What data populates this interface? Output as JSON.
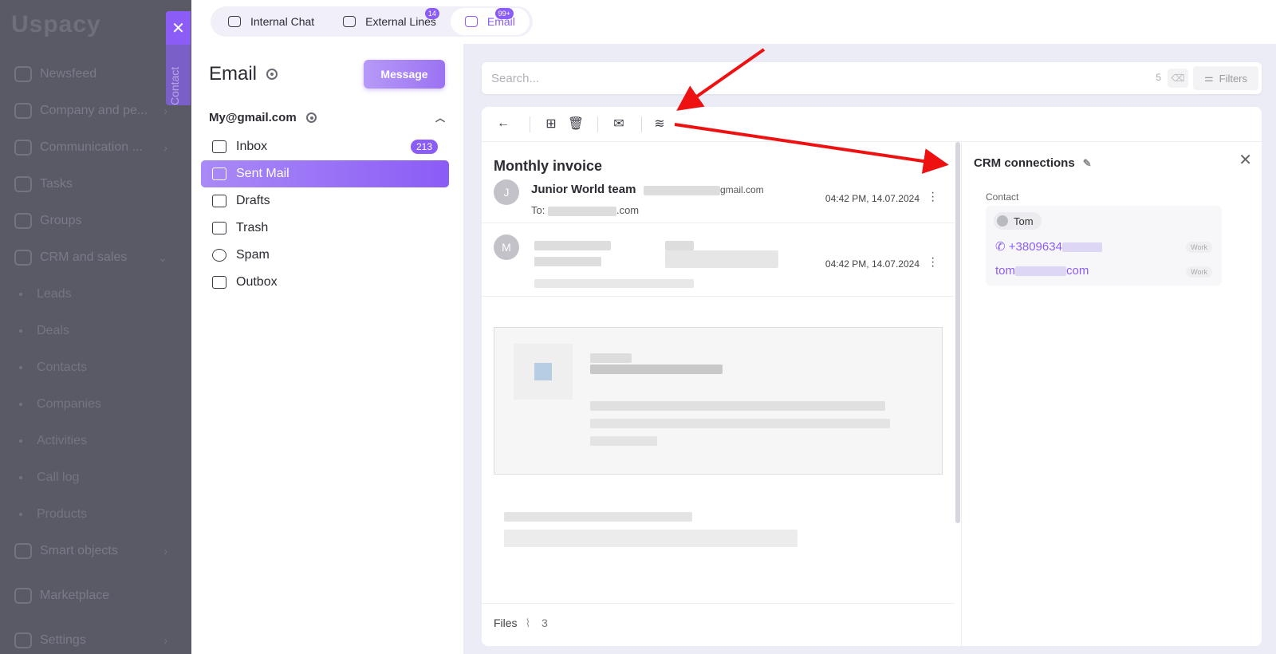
{
  "app": {
    "logo": "Uspacy",
    "nav": [
      {
        "label": "Newsfeed",
        "chevron": false
      },
      {
        "label": "Company and pe...",
        "chevron": true
      },
      {
        "label": "Communication ...",
        "chevron": true
      },
      {
        "label": "Tasks",
        "chevron": false
      },
      {
        "label": "Groups",
        "chevron": false
      },
      {
        "label": "CRM and sales",
        "chevron": true
      }
    ],
    "crm_sub": [
      "Leads",
      "Deals",
      "Contacts",
      "Companies",
      "Activities",
      "Call log",
      "Products"
    ],
    "nav_bottom": [
      {
        "label": "Smart objects",
        "chevron": true
      },
      {
        "label": "Marketplace",
        "chevron": false
      },
      {
        "label": "Settings",
        "chevron": true
      }
    ],
    "contact_tab_label": "Contact"
  },
  "tabs": [
    {
      "label": "Internal Chat",
      "badge": ""
    },
    {
      "label": "External Lines",
      "badge": "14"
    },
    {
      "label": "Email",
      "badge": "99+",
      "active": true
    }
  ],
  "email_panel": {
    "title": "Email",
    "message_button": "Message",
    "account": "My@gmail.com",
    "folders": [
      {
        "label": "Inbox",
        "count": "213",
        "icon": "inbox-icon"
      },
      {
        "label": "Sent Mail",
        "count": "",
        "icon": "send-icon",
        "active": true
      },
      {
        "label": "Drafts",
        "count": "",
        "icon": "edit-icon"
      },
      {
        "label": "Trash",
        "count": "",
        "icon": "trash-icon"
      },
      {
        "label": "Spam",
        "count": "",
        "icon": "alert-icon"
      },
      {
        "label": "Outbox",
        "count": "",
        "icon": "outbox-icon"
      }
    ]
  },
  "search": {
    "placeholder": "Search...",
    "count": "5",
    "filters_label": "Filters"
  },
  "thread": {
    "subject": "Monthly invoice",
    "message1": {
      "avatar": "J",
      "sender": "Junior World team",
      "sender_email_suffix": "gmail.com",
      "to_label": "To:",
      "to_suffix": ".com",
      "time": "04:42 PM, 14.07.2024"
    },
    "message2": {
      "avatar": "M",
      "time": "04:42 PM, 14.07.2024"
    },
    "files_label": "Files",
    "files_count": "3"
  },
  "crm": {
    "title": "CRM connections",
    "contact_label": "Contact",
    "contact_name": "Tom",
    "phone": "+3809634",
    "phone_tag": "Work",
    "email_prefix": "tom",
    "email_suffix": "com",
    "email_tag": "Work"
  },
  "colors": {
    "accent": "#8b5cf6",
    "arrow": "#ee1111"
  }
}
